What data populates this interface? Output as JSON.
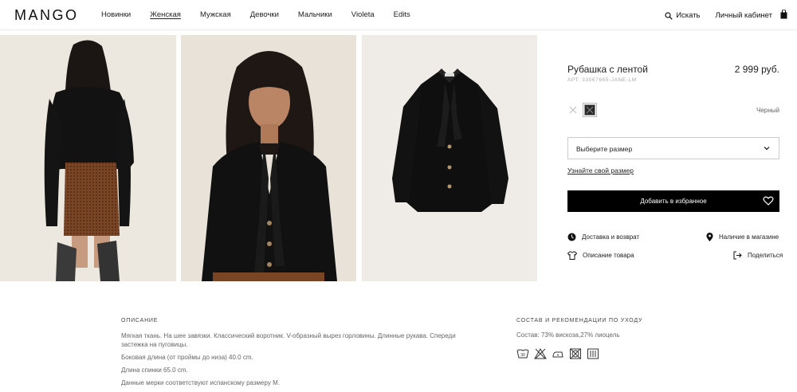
{
  "header": {
    "logo": "MANGO",
    "nav": [
      "Новинки",
      "Женская",
      "Мужская",
      "Девочки",
      "Мальчики",
      "Violeta",
      "Edits"
    ],
    "active_nav": "Женская",
    "search_label": "Искать",
    "account_label": "Личный кабинет",
    "bag_icon": "shopping-bag-icon"
  },
  "product": {
    "name": "Рубашка с лентой",
    "price": "2 999 руб.",
    "reference": "АРТ. 33067665-JANE-LM",
    "color_name": "Черный",
    "size_placeholder": "Выберите размер",
    "size_guide": "Узнайте свой размер",
    "add_button": "Добавить в избранное",
    "links": {
      "delivery": "Доставка и возврат",
      "store": "Наличие в магазине",
      "description": "Описание товара",
      "share": "Поделиться"
    }
  },
  "description": {
    "title": "ОПИСАНИЕ",
    "paragraphs": [
      "Мягкая ткань. На шее завязки. Классический воротник. V-образный вырез горловины. Длинные рукава. Спереди застежка на пуговицы.",
      "Боковая длина (от проймы до низа) 40.0 cm.",
      "Длина спинки 65.0 cm.",
      "Данные мерки соответствуют испанскому размеру M."
    ]
  },
  "care": {
    "title": "СОСТАВ И РЕКОМЕНДАЦИИ ПО УХОДУ",
    "composition": "Состав: 73% вискоза,27% лиоцель",
    "icons": [
      "wash-30-icon",
      "no-bleach-icon",
      "iron-low-icon",
      "no-tumble-dry-icon",
      "dry-clean-icon"
    ]
  },
  "colors": {
    "accent": "#000000",
    "photo_bg_1": "#ece7df",
    "photo_bg_2": "#e8e2d9",
    "photo_bg_3": "#efece8"
  }
}
